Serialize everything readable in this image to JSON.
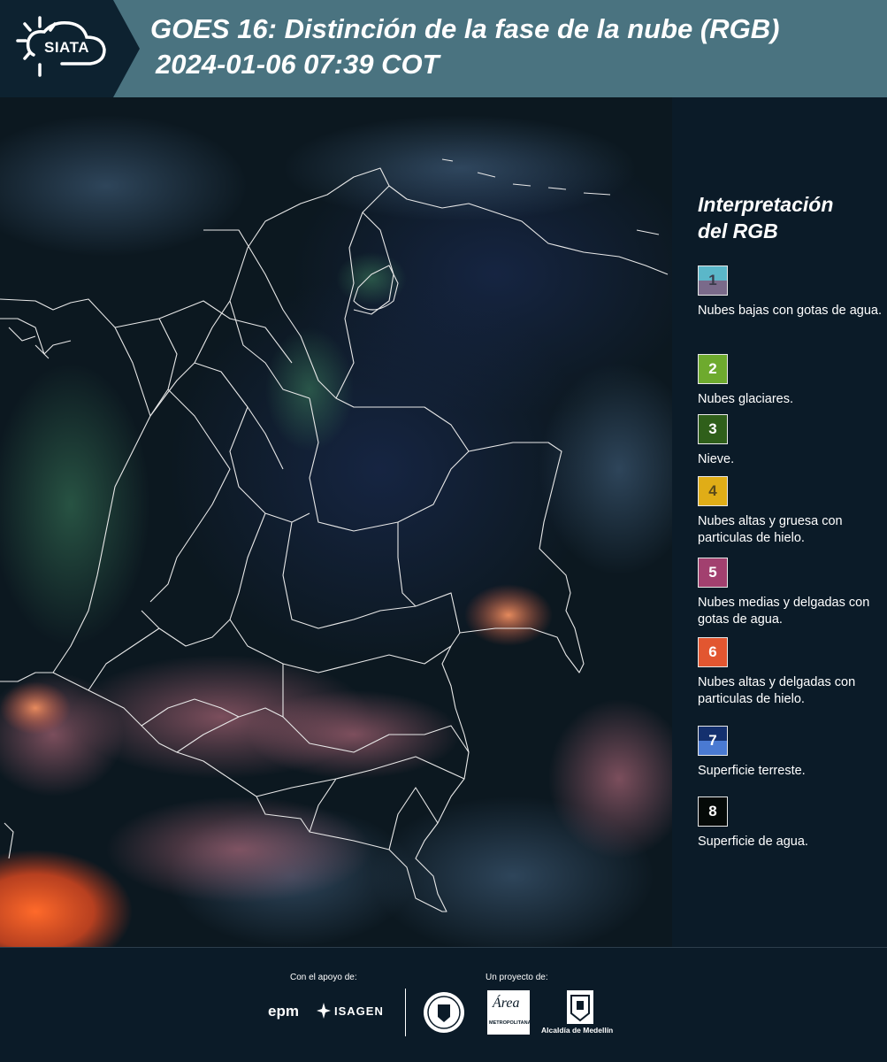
{
  "header": {
    "logo_text": "SIATA",
    "title": "GOES 16: Distinción de la fase de la nube (RGB)",
    "subtitle": "2024-01-06 07:39 COT"
  },
  "legend": {
    "title_line1": "Interpretación",
    "title_line2": "del RGB",
    "items": [
      {
        "number": "1",
        "label": "Nubes bajas con gotas de agua.",
        "color_top": "#5bb7c9",
        "color_bottom": "#7a6a8a",
        "num_color": "#3a3a4a"
      },
      {
        "number": "2",
        "label": "Nubes glaciares.",
        "color_top": "#6eaa2e",
        "color_bottom": "#6eaa2e",
        "num_color": "#ffffff"
      },
      {
        "number": "3",
        "label": "Nieve.",
        "color_top": "#2f5f1a",
        "color_bottom": "#2f5f1a",
        "num_color": "#ffffff"
      },
      {
        "number": "4",
        "label": "Nubes altas y gruesa con particulas de hielo.",
        "color_top": "#e0ad17",
        "color_bottom": "#e0ad17",
        "num_color": "#5a4a1a"
      },
      {
        "number": "5",
        "label": "Nubes medias y delgadas con gotas de agua.",
        "color_top": "#a2406f",
        "color_bottom": "#a2406f",
        "num_color": "#ffffff"
      },
      {
        "number": "6",
        "label": "Nubes altas y delgadas con particulas de hielo.",
        "color_top": "#e25630",
        "color_bottom": "#e25630",
        "num_color": "#ffffff"
      },
      {
        "number": "7",
        "label": "Superficie terreste.",
        "color_top": "#14306e",
        "color_bottom": "#4a7ad2",
        "num_color": "#ffffff"
      },
      {
        "number": "8",
        "label": "Superficie de agua.",
        "color_top": "#050a08",
        "color_bottom": "#050a08",
        "num_color": "#ffffff"
      }
    ]
  },
  "footer": {
    "support_label": "Con el apoyo de:",
    "project_label": "Un proyecto de:",
    "sponsor1": "epm",
    "sponsor2": "ISAGEN",
    "partner_metropolitana": "METROPOLITANA",
    "partner_area": "Área",
    "partner_alcaldia": "Alcaldía de Medellín"
  },
  "colors": {
    "header_bg": "#4a7380",
    "panel_bg": "#0b1b28",
    "logo_bg": "#0d2230"
  }
}
